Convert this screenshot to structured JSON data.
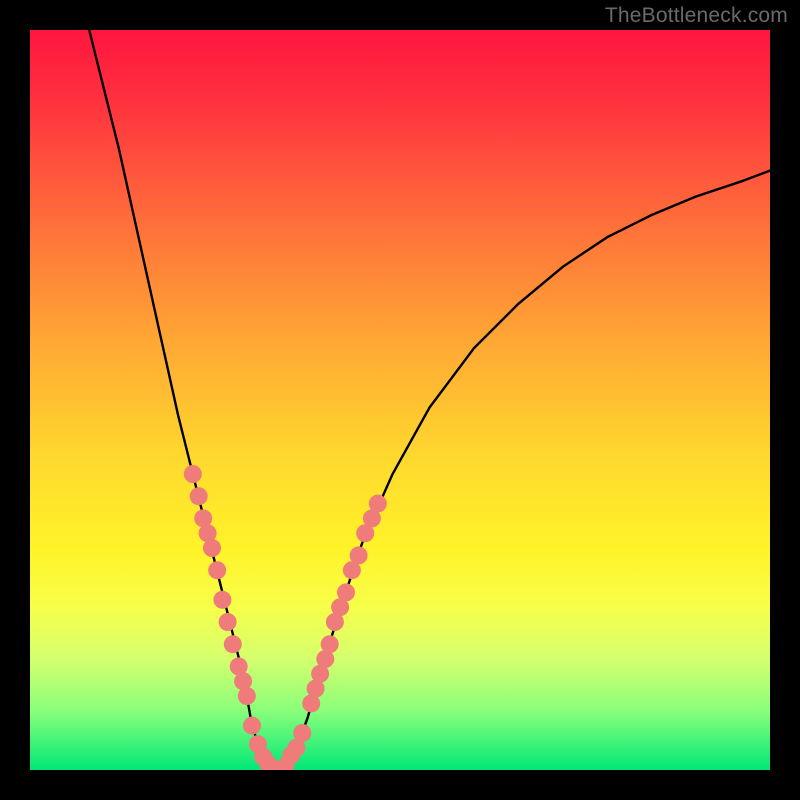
{
  "watermark": "TheBottleneck.com",
  "chart_data": {
    "type": "line",
    "title": "",
    "xlabel": "",
    "ylabel": "",
    "xlim": [
      0,
      100
    ],
    "ylim": [
      0,
      100
    ],
    "series": [
      {
        "name": "bottleneck-curve",
        "x": [
          8,
          10,
          12,
          14,
          16,
          18,
          20,
          22,
          24,
          25.5,
          27,
          28.5,
          29.3,
          30,
          31,
          32,
          33,
          34,
          35,
          36,
          37.5,
          39.5,
          42,
          45,
          49,
          54,
          60,
          66,
          72,
          78,
          84,
          90,
          96,
          100
        ],
        "y": [
          100,
          92,
          84,
          75,
          66,
          57,
          48,
          40,
          32,
          26,
          20,
          14,
          10,
          6,
          3,
          1,
          0,
          0,
          1,
          3,
          7,
          14,
          22,
          31,
          40,
          49,
          57,
          63,
          68,
          72,
          75,
          77.5,
          79.5,
          81
        ]
      }
    ],
    "highlight_segments": [
      {
        "name": "left-cluster",
        "xrange": [
          22,
          29.3
        ],
        "points": [
          {
            "x": 22.0,
            "y": 40
          },
          {
            "x": 22.8,
            "y": 37
          },
          {
            "x": 23.4,
            "y": 34
          },
          {
            "x": 24.0,
            "y": 32
          },
          {
            "x": 24.6,
            "y": 30
          },
          {
            "x": 25.3,
            "y": 27
          },
          {
            "x": 26.0,
            "y": 23
          },
          {
            "x": 26.7,
            "y": 20
          },
          {
            "x": 27.4,
            "y": 17
          },
          {
            "x": 28.2,
            "y": 14
          },
          {
            "x": 28.8,
            "y": 12
          },
          {
            "x": 29.3,
            "y": 10
          }
        ]
      },
      {
        "name": "bottom-cluster",
        "xrange": [
          30,
          36.8
        ],
        "points": [
          {
            "x": 30.0,
            "y": 6
          },
          {
            "x": 30.8,
            "y": 3.5
          },
          {
            "x": 31.5,
            "y": 1.8
          },
          {
            "x": 32.2,
            "y": 0.8
          },
          {
            "x": 33.0,
            "y": 0
          },
          {
            "x": 33.8,
            "y": 0
          },
          {
            "x": 34.5,
            "y": 0.5
          },
          {
            "x": 35.3,
            "y": 2
          },
          {
            "x": 36.0,
            "y": 3
          },
          {
            "x": 36.8,
            "y": 5
          }
        ]
      },
      {
        "name": "right-cluster",
        "xrange": [
          38,
          47
        ],
        "points": [
          {
            "x": 38.0,
            "y": 9
          },
          {
            "x": 38.6,
            "y": 11
          },
          {
            "x": 39.2,
            "y": 13
          },
          {
            "x": 39.9,
            "y": 15
          },
          {
            "x": 40.5,
            "y": 17
          },
          {
            "x": 41.2,
            "y": 20
          },
          {
            "x": 41.9,
            "y": 22
          },
          {
            "x": 42.7,
            "y": 24
          },
          {
            "x": 43.5,
            "y": 27
          },
          {
            "x": 44.4,
            "y": 29
          },
          {
            "x": 45.3,
            "y": 32
          },
          {
            "x": 46.2,
            "y": 34
          },
          {
            "x": 47.0,
            "y": 36
          }
        ]
      }
    ],
    "colors": {
      "curve": "#000000",
      "highlight": "#ef7b7b",
      "gradient_top": "#ff163f",
      "gradient_bottom": "#00e878"
    }
  }
}
